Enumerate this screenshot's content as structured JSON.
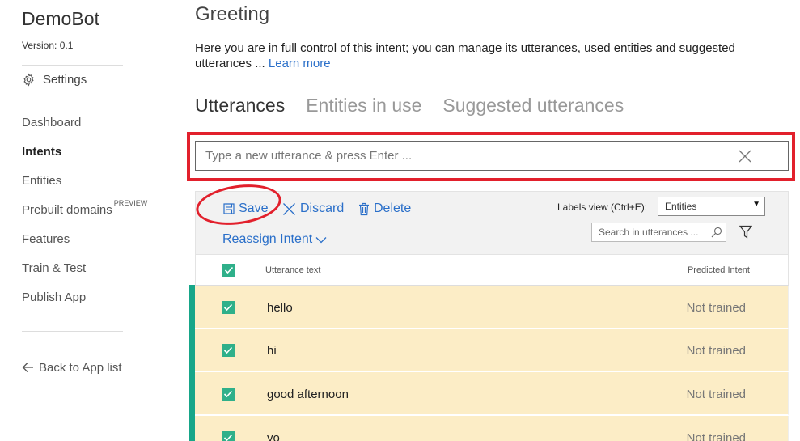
{
  "sidebar": {
    "app_name": "DemoBot",
    "version": "Version:  0.1",
    "settings_label": "Settings",
    "nav": [
      {
        "label": "Dashboard",
        "badge": ""
      },
      {
        "label": "Intents",
        "badge": ""
      },
      {
        "label": "Entities",
        "badge": ""
      },
      {
        "label": "Prebuilt domains",
        "badge": "PREVIEW"
      },
      {
        "label": "Features",
        "badge": ""
      },
      {
        "label": "Train & Test",
        "badge": ""
      },
      {
        "label": "Publish App",
        "badge": ""
      }
    ],
    "active_nav": "Intents",
    "back_label": "Back to App list"
  },
  "main": {
    "title": "Greeting",
    "description": "Here you are in full control of this intent; you can manage its utterances, used entities and suggested utterances ... ",
    "learn_more": "Learn more",
    "tabs": [
      {
        "label": "Utterances",
        "active": true
      },
      {
        "label": "Entities in use",
        "active": false
      },
      {
        "label": "Suggested utterances",
        "active": false
      }
    ],
    "utterance_input": {
      "placeholder": "Type a new utterance & press Enter ...",
      "value": ""
    }
  },
  "toolbar": {
    "save_label": "Save",
    "discard_label": "Discard",
    "delete_label": "Delete",
    "reassign_label": "Reassign Intent",
    "labels_view_label": "Labels view (Ctrl+E):",
    "labels_view_value": "Entities",
    "search_placeholder": "Search in utterances ..."
  },
  "table": {
    "columns": [
      "Utterance text",
      "Predicted Intent"
    ],
    "rows": [
      {
        "text": "hello",
        "predicted": "Not trained",
        "checked": true
      },
      {
        "text": "hi",
        "predicted": "Not trained",
        "checked": true
      },
      {
        "text": "good afternoon",
        "predicted": "Not trained",
        "checked": true
      },
      {
        "text": "yo",
        "predicted": "Not trained",
        "checked": true
      }
    ]
  },
  "colors": {
    "accent_link": "#2a6fc9",
    "checkbox": "#2fb08a",
    "row_highlight": "#fcedc6",
    "row_accent_bar": "#17a689",
    "annotation_red": "#e2202c"
  }
}
